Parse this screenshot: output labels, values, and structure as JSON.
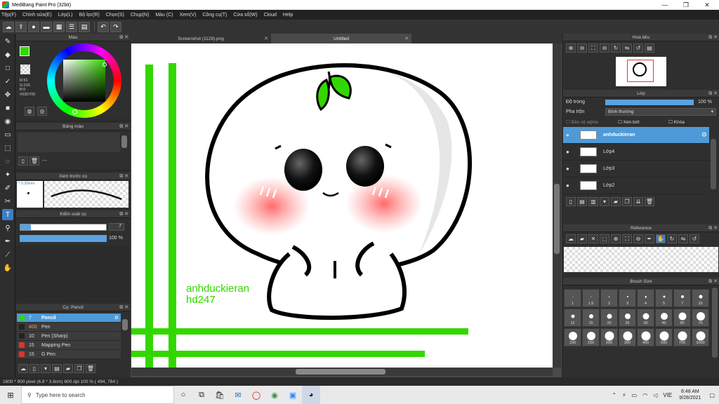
{
  "window": {
    "title": "MediBang Paint Pro (32bit)",
    "controls": [
      "—",
      "❐",
      "✕"
    ]
  },
  "menu": [
    "Tệp(F)",
    "Chỉnh sửa(E)",
    "Lớp(L)",
    "Bộ lọc(R)",
    "Chọn(S)",
    "Chụp(N)",
    "Màu (C)",
    "Xem(V)",
    "Công cụ(T)",
    "Cửa sổ(W)",
    "Cloud",
    "Help"
  ],
  "toolbar_icons": [
    "cloud-icon",
    "upload-icon",
    "comment-icon",
    "chat-icon",
    "grid-icon",
    "layout-icon",
    "panel-icon",
    "undo-icon",
    "redo-icon"
  ],
  "tools": [
    "brush-icon",
    "eraser-icon",
    "rectangle-icon",
    "pen-icon",
    "move-icon",
    "fill-rect-icon",
    "bucket-icon",
    "gradient-icon",
    "select-icon",
    "lasso-icon",
    "magic-wand-icon",
    "selection-pen-icon",
    "selection-eraser-icon",
    "text-icon",
    "operation-icon",
    "eyedropper-icon",
    "pipette-icon",
    "hand-icon"
  ],
  "color_panel": {
    "title": "Màu",
    "rgb": [
      "R:51",
      "G:215",
      "B:0"
    ],
    "hex": "#33D700",
    "fg_color": "#33D700"
  },
  "palette_panel": {
    "title": "Bảng màu",
    "extra": "---"
  },
  "brush_preview": {
    "title": "Xem trước cọ",
    "size": "0.30mm"
  },
  "brush_control": {
    "title": "Kiểm soát cọ",
    "size_value": "7",
    "opacity_value": "100 %"
  },
  "brush_list": {
    "title": "Cọ: Pencil",
    "items": [
      {
        "size": "7",
        "name": "Pencil",
        "color": "#33D700",
        "active": true
      },
      {
        "size": "400",
        "name": "Pen",
        "color": "#222222",
        "active": false
      },
      {
        "size": "10",
        "name": "Pen (Sharp)",
        "color": "#222222",
        "active": false
      },
      {
        "size": "15",
        "name": "Mapping Pen",
        "color": "#e03030",
        "active": false
      },
      {
        "size": "15",
        "name": "G Pen",
        "color": "#e03030",
        "active": false
      }
    ]
  },
  "tabs": [
    {
      "label": "Screenshot (1129).png",
      "active": false
    },
    {
      "label": "Untitled",
      "active": true
    }
  ],
  "canvas": {
    "watermark_line1": "anhduckieran",
    "watermark_line2": "hd247",
    "line_color": "#33D700"
  },
  "navigator": {
    "title": "Hoa tiêu"
  },
  "layers": {
    "title": "Lớp",
    "opacity_label": "Độ trong",
    "opacity_value": "100 %",
    "blend_label": "Pha trộn",
    "blend_value": "Bình thường",
    "protect_alpha": "Bảo vệ alpha",
    "clipping": "Xén bớt",
    "lock": "Khóa",
    "items": [
      {
        "name": "anhduckieran",
        "active": true
      },
      {
        "name": "Lớp4",
        "active": false
      },
      {
        "name": "Lớp3",
        "active": false
      },
      {
        "name": "Lớp2",
        "active": false
      }
    ]
  },
  "reference": {
    "title": "Reference"
  },
  "brush_size": {
    "title": "Brush Size",
    "sizes": [
      "1",
      "1.5",
      "2",
      "3",
      "4",
      "5",
      "7",
      "10",
      "12",
      "15",
      "20",
      "25",
      "30",
      "40",
      "50",
      "70",
      "100",
      "150",
      "200",
      "300",
      "400",
      "500",
      "700",
      "1000"
    ]
  },
  "status": {
    "text": "1600 * 900 pixel  (6.8 * 3.8cm)  600 dpi  100 %  ( 494, 764 )"
  },
  "taskbar": {
    "search_placeholder": "Type here to search",
    "time": "8:48 AM",
    "date": "9/28/2021",
    "lang": "VIE"
  }
}
